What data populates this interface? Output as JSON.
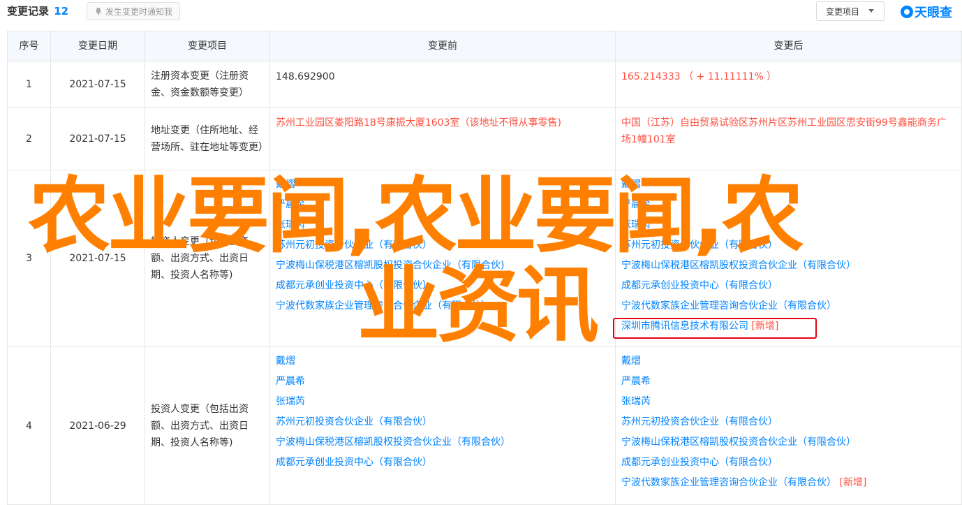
{
  "header": {
    "title": "变更记录",
    "count": "12",
    "notify_label": "发生变更时通知我",
    "filter_select": "变更项目",
    "logo_text": "天眼查"
  },
  "table": {
    "columns": [
      "序号",
      "变更日期",
      "变更项目",
      "变更前",
      "变更后"
    ],
    "rows": [
      {
        "num": "1",
        "date": "2021-07-15",
        "item": "注册资本变更（注册资金、资金数额等变更）",
        "before": [
          "148.692900"
        ],
        "after": [
          "165.214333 （ + 11.11111% ）"
        ]
      },
      {
        "num": "2",
        "date": "2021-07-15",
        "item": "地址变更（住所地址、经营场所、驻在地址等变更）",
        "before": [
          "苏州工业园区娄阳路18号康振大厦1603室（该地址不得从事零售)"
        ],
        "after": [
          "中国（江苏）自由贸易试验区苏州片区苏州工业园区思安街99号鑫能商务广场1幢101室"
        ]
      },
      {
        "num": "3",
        "date": "2021-07-15",
        "item": "投资人变更（包括出资额、出资方式、出资日期、投资人名称等)",
        "before": [
          "戴熠",
          "严晨希",
          "张瑞芮",
          "苏州元初投资合伙企业（有限合伙）",
          "宁波梅山保税港区榕凯股权投资合伙企业（有限合伙)",
          "成都元承创业投资中心（有限合伙）",
          "宁波代数家族企业管理咨询合伙企业（有限合伙）"
        ],
        "after": [
          "戴熠",
          "严晨希",
          "张瑞芮",
          "苏州元初投资合伙企业（有限合伙）",
          "宁波梅山保税港区榕凯股权投资合伙企业（有限合伙）",
          "成都元承创业投资中心（有限合伙）",
          "宁波代数家族企业管理咨询合伙企业（有限合伙）",
          "深圳市腾讯信息技术有限公司"
        ],
        "after_new_tag": "[新增]"
      },
      {
        "num": "4",
        "date": "2021-06-29",
        "item": "投资人变更（包括出资额、出资方式、出资日期、投资人名称等)",
        "before": [
          "戴熠",
          "严晨希",
          "张瑞芮",
          "苏州元初投资合伙企业（有限合伙）",
          "宁波梅山保税港区榕凯股权投资合伙企业（有限合伙）",
          "成都元承创业投资中心（有限合伙）"
        ],
        "after": [
          "戴熠",
          "严晨希",
          "张瑞芮",
          "苏州元初投资合伙企业（有限合伙）",
          "宁波梅山保税港区榕凯股权投资合伙企业（有限合伙）",
          "成都元承创业投资中心（有限合伙）",
          "宁波代数家族企业管理咨询合伙企业（有限合伙）"
        ],
        "after_new_tag": "[新增]"
      }
    ]
  },
  "watermark": {
    "line1": "农业要闻,农业要闻,农",
    "line2": "业资讯"
  },
  "colors": {
    "accent": "#0084ff",
    "changed": "#fe4f3f",
    "watermark": "#ff8000",
    "highlight": "#e60012"
  }
}
